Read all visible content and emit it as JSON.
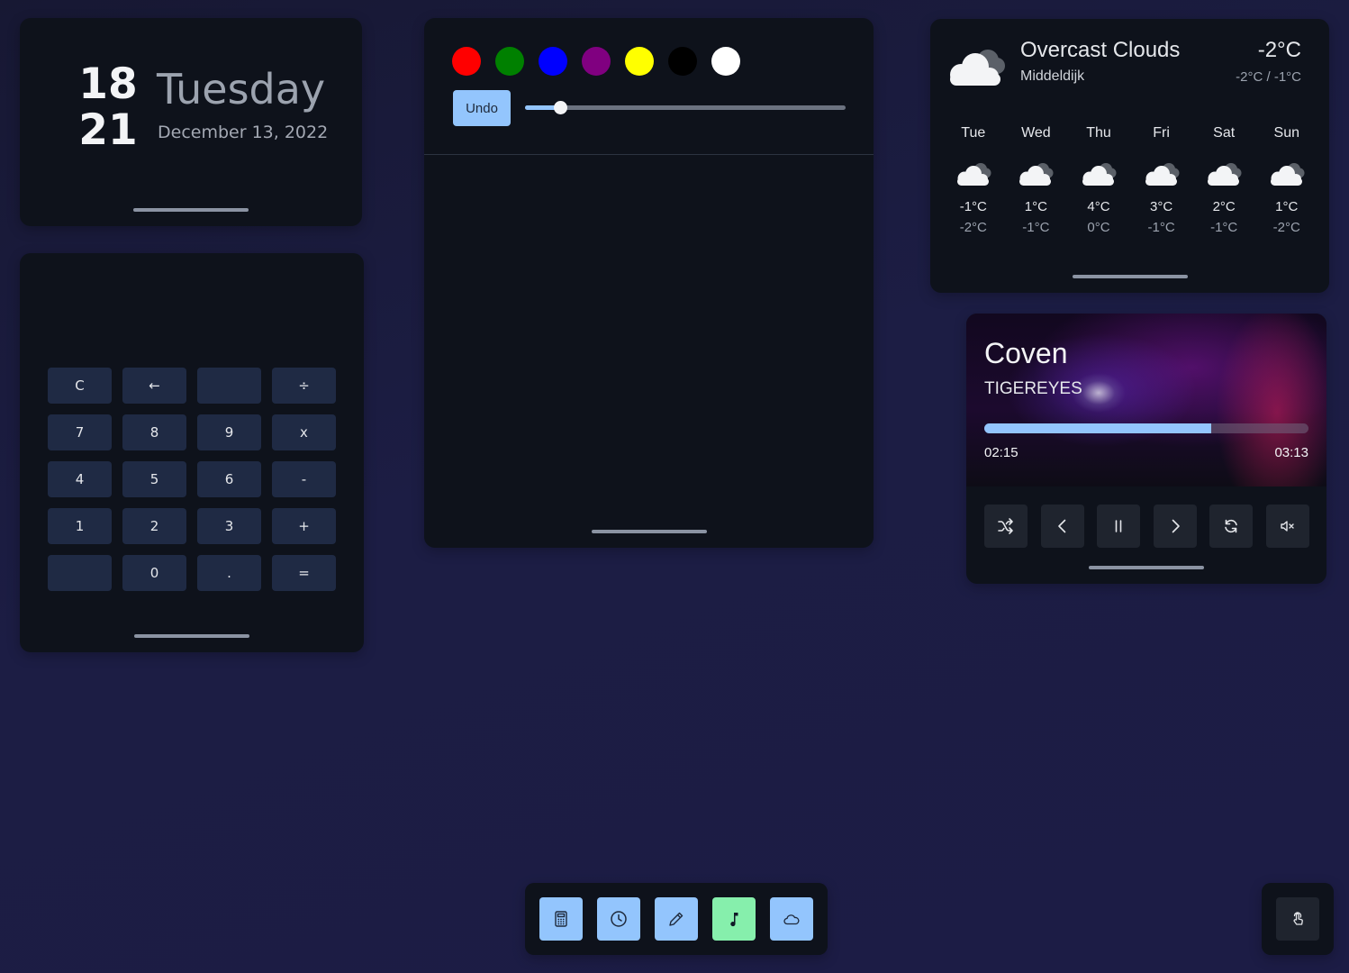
{
  "clock": {
    "hours": "18",
    "minutes": "21",
    "weekday": "Tuesday",
    "date": "December 13, 2022"
  },
  "calculator": {
    "keys": [
      {
        "label": "C",
        "name": "calc-key-clear"
      },
      {
        "label": "←",
        "name": "calc-key-backspace"
      },
      {
        "label": "",
        "name": "calc-key-blank"
      },
      {
        "label": "÷",
        "name": "calc-key-divide"
      },
      {
        "label": "7",
        "name": "calc-key-7"
      },
      {
        "label": "8",
        "name": "calc-key-8"
      },
      {
        "label": "9",
        "name": "calc-key-9"
      },
      {
        "label": "x",
        "name": "calc-key-multiply"
      },
      {
        "label": "4",
        "name": "calc-key-4"
      },
      {
        "label": "5",
        "name": "calc-key-5"
      },
      {
        "label": "6",
        "name": "calc-key-6"
      },
      {
        "label": "-",
        "name": "calc-key-minus"
      },
      {
        "label": "1",
        "name": "calc-key-1"
      },
      {
        "label": "2",
        "name": "calc-key-2"
      },
      {
        "label": "3",
        "name": "calc-key-3"
      },
      {
        "label": "+",
        "name": "calc-key-plus"
      },
      {
        "label": "",
        "name": "calc-key-blank"
      },
      {
        "label": "0",
        "name": "calc-key-0"
      },
      {
        "label": ".",
        "name": "calc-key-decimal"
      },
      {
        "label": "=",
        "name": "calc-key-equals"
      }
    ]
  },
  "drawing": {
    "colors": [
      {
        "name": "red",
        "hex": "#ff0000"
      },
      {
        "name": "green",
        "hex": "#008000"
      },
      {
        "name": "blue",
        "hex": "#0000ff"
      },
      {
        "name": "purple",
        "hex": "#800080"
      },
      {
        "name": "yellow",
        "hex": "#ffff00"
      },
      {
        "name": "black",
        "hex": "#000000"
      },
      {
        "name": "white",
        "hex": "#ffffff"
      }
    ],
    "undo_label": "Undo",
    "brush_size_fraction": 0.11
  },
  "weather": {
    "condition": "Overcast Clouds",
    "location": "Middeldijk",
    "current_temp": "-2°C",
    "range": "-2°C / -1°C",
    "icon": "cloud-icon",
    "forecast": [
      {
        "day": "Tue",
        "high": "-1°C",
        "low": "-2°C",
        "icon": "cloud-icon"
      },
      {
        "day": "Wed",
        "high": "1°C",
        "low": "-1°C",
        "icon": "cloud-icon"
      },
      {
        "day": "Thu",
        "high": "4°C",
        "low": "0°C",
        "icon": "cloud-icon"
      },
      {
        "day": "Fri",
        "high": "3°C",
        "low": "-1°C",
        "icon": "cloud-icon"
      },
      {
        "day": "Sat",
        "high": "2°C",
        "low": "-1°C",
        "icon": "cloud-icon"
      },
      {
        "day": "Sun",
        "high": "1°C",
        "low": "-2°C",
        "icon": "cloud-icon"
      }
    ]
  },
  "music": {
    "title": "Coven",
    "artist": "TIGEREYES",
    "current_time": "02:15",
    "duration": "03:13",
    "progress_fraction": 0.7,
    "controls": [
      "shuffle-icon",
      "previous-icon",
      "pause-icon",
      "next-icon",
      "repeat-icon",
      "mute-icon"
    ]
  },
  "dock": {
    "apps": [
      {
        "name": "calculator",
        "icon": "calculator-icon",
        "color": "#93c5fd"
      },
      {
        "name": "clock",
        "icon": "clock-icon",
        "color": "#93c5fd"
      },
      {
        "name": "drawing",
        "icon": "pencil-icon",
        "color": "#93c5fd"
      },
      {
        "name": "music",
        "icon": "music-note-icon",
        "color": "#86efac"
      },
      {
        "name": "weather",
        "icon": "cloud-sun-icon",
        "color": "#93c5fd"
      }
    ],
    "touch_icon": "touch-icon"
  },
  "theme": {
    "accent": "#93c5fd",
    "active": "#86efac",
    "widget_bg": "#0e121b",
    "key_bg": "#1f2a44"
  }
}
